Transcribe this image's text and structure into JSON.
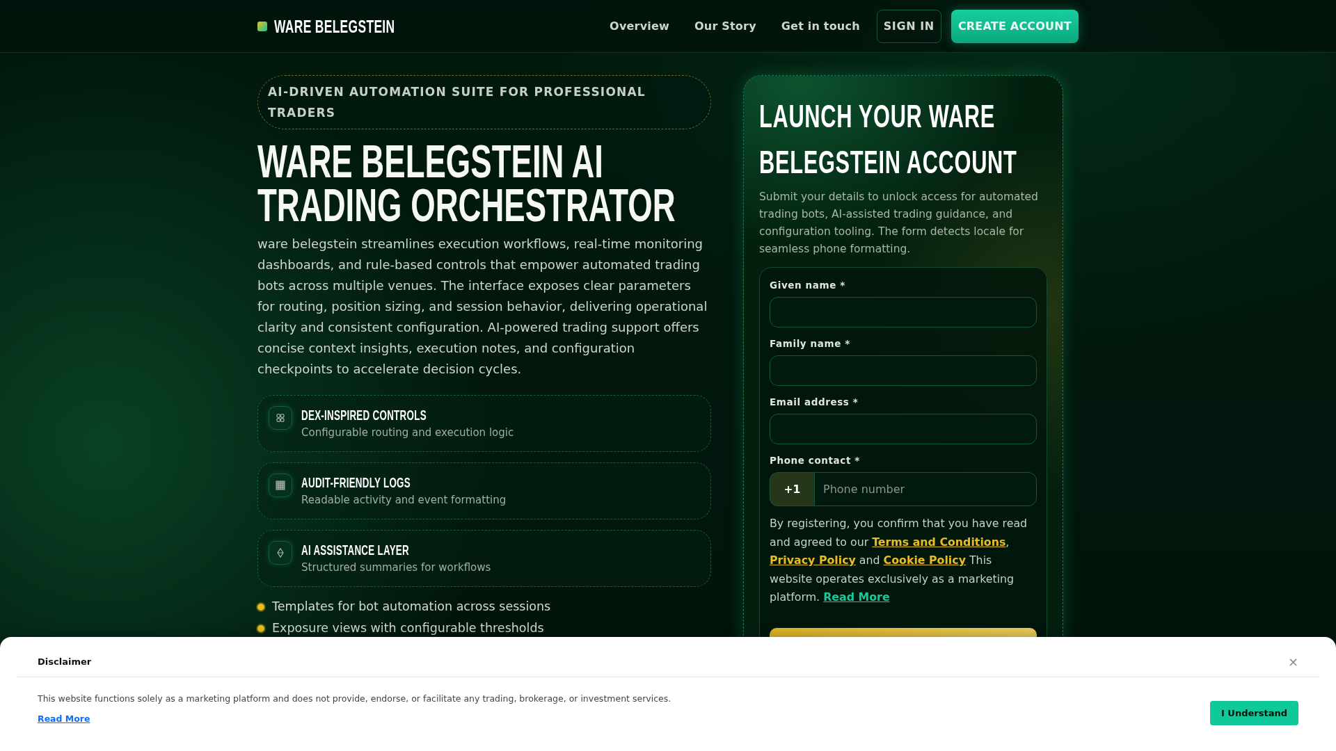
{
  "header": {
    "brand": "WARE BELEGSTEIN",
    "nav": [
      {
        "label": "Overview"
      },
      {
        "label": "Our Story"
      },
      {
        "label": "Get in touch"
      }
    ],
    "sign_in": "SIGN IN",
    "create_account": "CREATE ACCOUNT"
  },
  "hero": {
    "eyebrow": "AI-DRIVEN AUTOMATION SUITE FOR PROFESSIONAL TRADERS",
    "title": "WARE BELEGSTEIN AI TRADING ORCHESTRATOR",
    "description": "ware belegstein streamlines execution workflows, real-time monitoring dashboards, and rule-based controls that empower automated trading bots across multiple venues. The interface exposes clear parameters for routing, position sizing, and session behavior, delivering operational clarity and consistent configuration. AI-powered trading support offers concise context insights, execution notes, and configuration checkpoints to accelerate decision cycles.",
    "features": [
      {
        "title": "DEX-INSPIRED CONTROLS",
        "subtitle": "Configurable routing and execution logic"
      },
      {
        "title": "AUDIT-FRIENDLY LOGS",
        "subtitle": "Readable activity and event formatting"
      },
      {
        "title": "AI ASSISTANCE LAYER",
        "subtitle": "Structured summaries for workflows"
      }
    ],
    "bullets": [
      "Templates for bot automation across sessions",
      "Exposure views with configurable thresholds"
    ]
  },
  "signup": {
    "title": "LAUNCH YOUR WARE BELEGSTEIN ACCOUNT",
    "description": "Submit your details to unlock access for automated trading bots, AI-assisted trading guidance, and configuration tooling. The form detects locale for seamless phone formatting.",
    "fields": [
      {
        "kind": "text",
        "label": "Given name *"
      },
      {
        "kind": "text",
        "label": "Family name *"
      },
      {
        "kind": "text",
        "label": "Email address *"
      },
      {
        "kind": "phone",
        "label": "Phone contact *",
        "prefix": "+1",
        "placeholder": "Phone number"
      }
    ],
    "consent": [
      {
        "kind": "text",
        "text": "By registering, you confirm that you have read and agreed to our "
      },
      {
        "kind": "link",
        "text": "Terms and Conditions"
      },
      {
        "kind": "text",
        "text": ", "
      },
      {
        "kind": "link",
        "text": "Privacy Policy"
      },
      {
        "kind": "text",
        "text": " and "
      },
      {
        "kind": "link",
        "text": "Cookie Policy"
      },
      {
        "kind": "text",
        "text": " This website operates exclusively as a marketing platform. "
      },
      {
        "kind": "more",
        "text": "Read More"
      }
    ]
  },
  "disclaimer": {
    "title": "Disclaimer",
    "close": "×",
    "text": "This website functions solely as a marketing platform and does not provide, endorse, or facilitate any trading, brokerage, or investment services.",
    "read_more": "Read More",
    "button": "I Understand"
  }
}
